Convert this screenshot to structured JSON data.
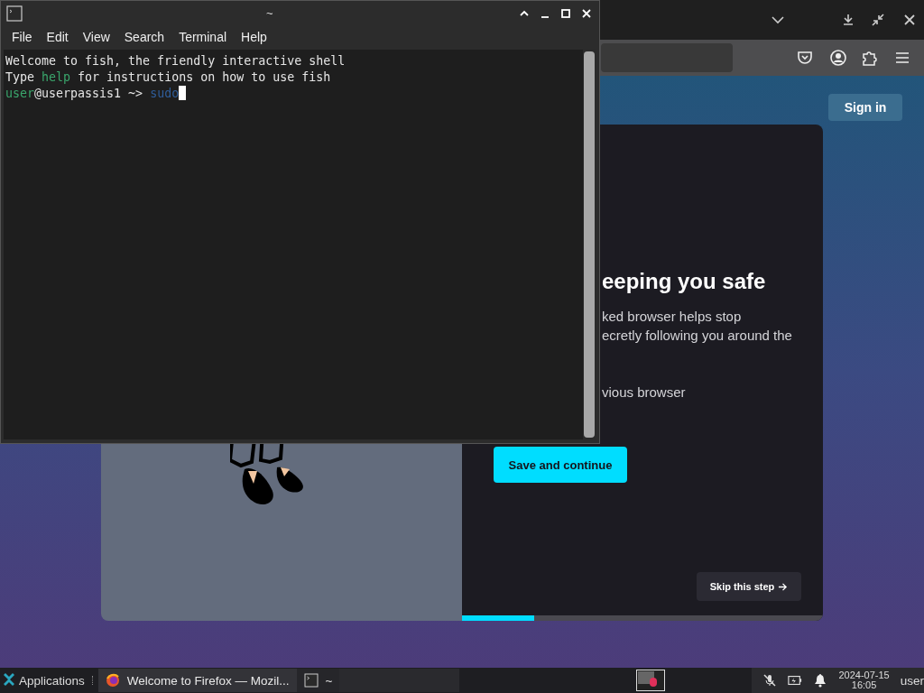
{
  "firefox": {
    "sign_in": "Sign in",
    "card": {
      "heading": "eeping you safe",
      "lines": [
        "ked browser helps stop",
        "ecretly following you around the"
      ],
      "line_3": "vious browser",
      "primary_button": "Save and continue",
      "skip_button": "Skip this step",
      "progress": {
        "level": 0.2
      }
    }
  },
  "terminal": {
    "title": "~",
    "menu": [
      "File",
      "Edit",
      "View",
      "Search",
      "Terminal",
      "Help"
    ],
    "lines": [
      [
        {
          "kind": "plain",
          "text": "Welcome to fish, the friendly interactive shell"
        }
      ],
      [
        {
          "kind": "plain",
          "text": "Type "
        },
        {
          "kind": "keyword",
          "text": "help"
        },
        {
          "kind": "plain",
          "text": " for instructions on how to use fish"
        }
      ],
      [
        {
          "kind": "user",
          "text": "user"
        },
        {
          "kind": "plain",
          "text": "@userpassis1 ~> "
        },
        {
          "kind": "command",
          "text": "sudo"
        },
        {
          "kind": "cursor"
        }
      ]
    ]
  },
  "taskbar": {
    "applications": "Applications",
    "tasks": [
      {
        "kind": "browser",
        "label": "Welcome to Firefox — Mozil...",
        "selected": false
      },
      {
        "kind": "terminal",
        "label": "~",
        "selected": true
      }
    ],
    "date": "2024-07-15",
    "time": "16:05",
    "user": "user"
  }
}
